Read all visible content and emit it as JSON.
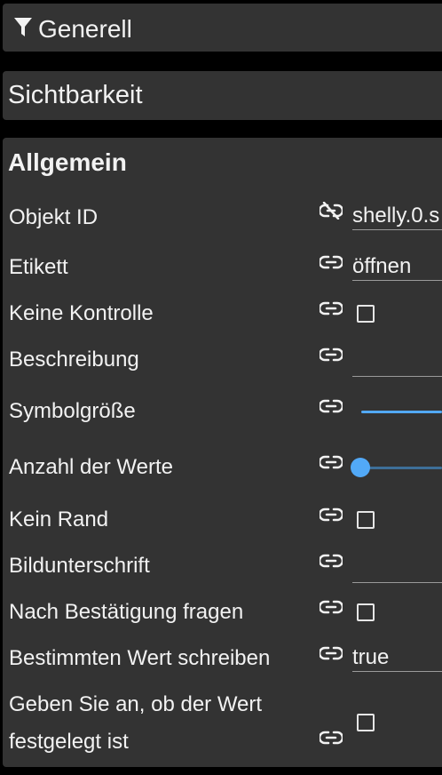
{
  "sections": {
    "generell": {
      "title": "Generell"
    },
    "sichtbarkeit": {
      "title": "Sichtbarkeit"
    }
  },
  "panel": {
    "title": "Allgemein",
    "rows": {
      "objekt_id": {
        "label": "Objekt ID",
        "value": "shelly.0.s",
        "linked": false
      },
      "etikett": {
        "label": "Etikett",
        "value": "öffnen"
      },
      "keine_kontrolle": {
        "label": "Keine Kontrolle",
        "checked": false
      },
      "beschreibung": {
        "label": "Beschreibung",
        "value": ""
      },
      "symbolgroesse": {
        "label": "Symbolgröße",
        "slider_value": 1.0
      },
      "anzahl_werte": {
        "label": "Anzahl der Werte",
        "slider_value": 0.0
      },
      "kein_rand": {
        "label": "Kein Rand",
        "checked": false
      },
      "bildunterschrift": {
        "label": "Bildunterschrift",
        "value": ""
      },
      "bestaetigung": {
        "label": "Nach Bestätigung fragen",
        "checked": false
      },
      "bestimmten_wert": {
        "label": "Bestimmten Wert schreiben",
        "value": "true"
      },
      "wert_festgelegt": {
        "label_line1": "Geben Sie an, ob der Wert",
        "label_line2": "festgelegt ist",
        "checked": false
      }
    }
  },
  "colors": {
    "background": "#000000",
    "panel": "#333333",
    "text": "#f2f2f2",
    "accent": "#52a9f7",
    "slider_track_inactive": "#3d6f98"
  },
  "icons": {
    "filter": "filter-icon",
    "link": "link-icon",
    "link_off": "link-off-icon"
  }
}
